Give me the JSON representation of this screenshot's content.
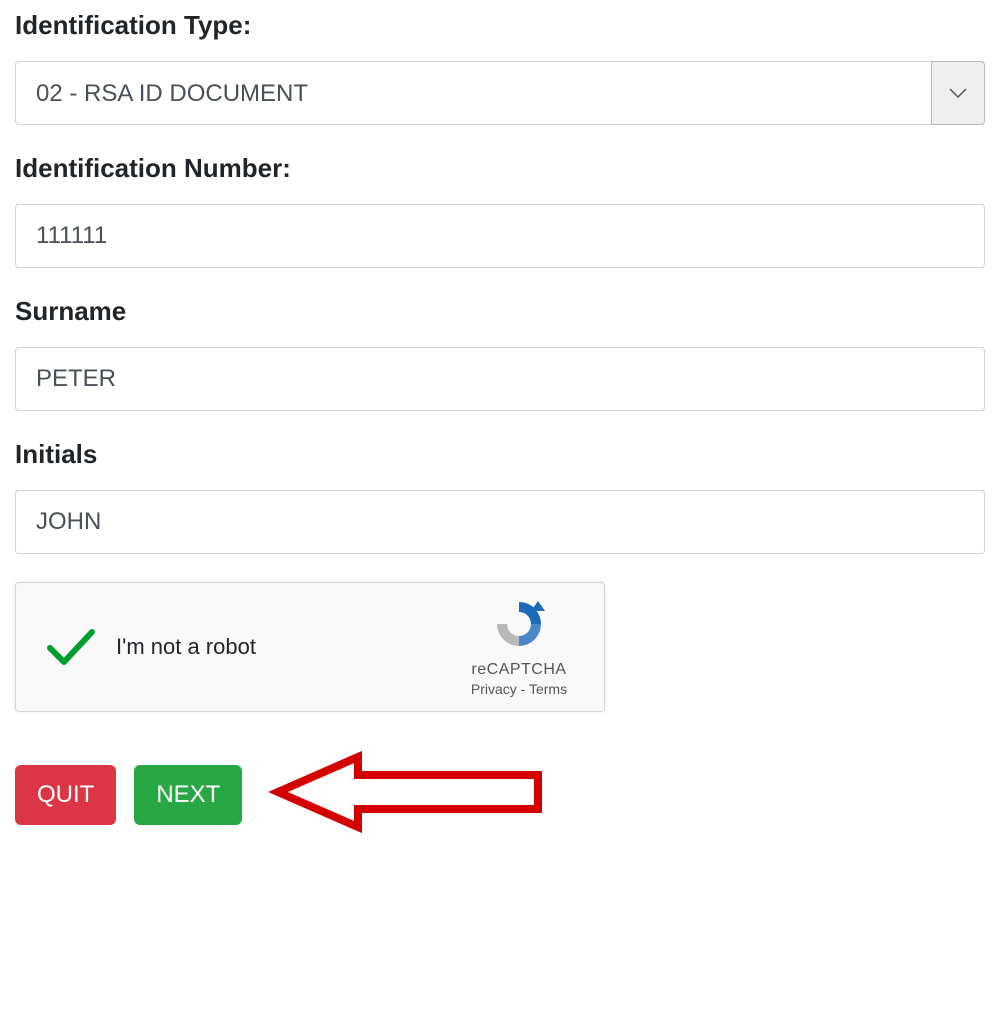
{
  "form": {
    "id_type": {
      "label": "Identification Type:",
      "value": "02 - RSA ID DOCUMENT"
    },
    "id_number": {
      "label": "Identification Number:",
      "value": "111111"
    },
    "surname": {
      "label": "Surname",
      "value": "PETER"
    },
    "initials": {
      "label": "Initials",
      "value": "JOHN"
    }
  },
  "recaptcha": {
    "label": "I'm not a robot",
    "brand": "reCAPTCHA",
    "links": "Privacy - Terms"
  },
  "buttons": {
    "quit": "QUIT",
    "next": "NEXT"
  }
}
